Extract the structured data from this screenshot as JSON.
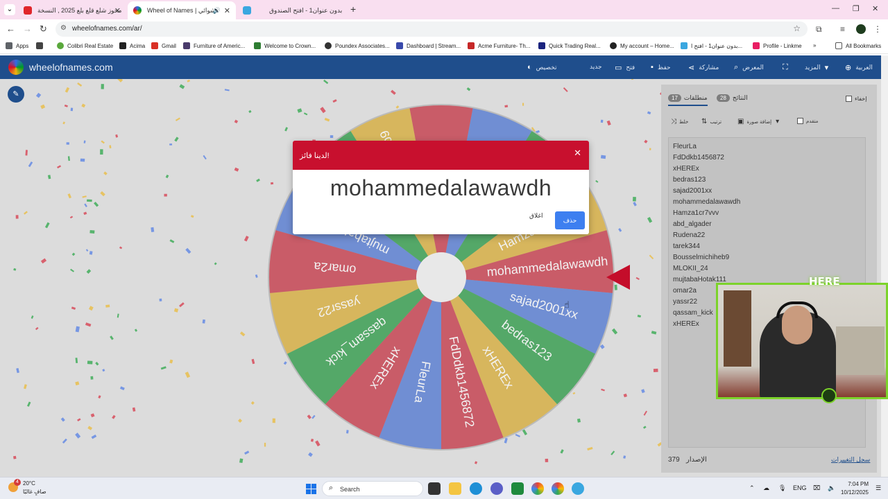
{
  "browser": {
    "tabs": [
      {
        "title": "محوز شلع قلع بلع 2025 , النسخة",
        "active": false
      },
      {
        "title": "Wheel of Names | العشوائي",
        "active": true
      },
      {
        "title": "بدون عنوان1 - افتح الصندوق",
        "active": false
      }
    ],
    "url": "wheelofnames.com/ar/",
    "bookmarks": [
      "Apps",
      "Colibri Real Estate",
      "Acima",
      "Gmail",
      "Furniture of Americ...",
      "Welcome to Crown...",
      "Poundex Associates...",
      "Dashboard | Stream...",
      "Acme Furniture- Th...",
      "Quick Trading Real...",
      "My account – Home...",
      "بدون عنوان1 - افتح ا...",
      "Profile - Linkme"
    ],
    "all_bookmarks": "All Bookmarks"
  },
  "app": {
    "brand": "wheelofnames.com",
    "header_items": {
      "language": "العربية",
      "more": "المزيد",
      "gallery": "المعرض",
      "share": "مشاركة",
      "save": "حفظ",
      "open": "فتح",
      "new": "جديد",
      "customize": "تخصيص"
    }
  },
  "wheel": {
    "segments": [
      {
        "label": "tarek344",
        "color": "#d50f25"
      },
      {
        "label": "Rudena22",
        "color": "#3369e8"
      },
      {
        "label": "abd_algader",
        "color": "#009925"
      },
      {
        "label": "Hamza1cr7vvv",
        "color": "#eeb211"
      },
      {
        "label": "mohammedalawawdh",
        "color": "#d50f25"
      },
      {
        "label": "sajad2001xx",
        "color": "#3369e8"
      },
      {
        "label": "bedras123",
        "color": "#009925"
      },
      {
        "label": "xHEREx",
        "color": "#eeb211"
      },
      {
        "label": "FdDdkb1456872",
        "color": "#d50f25"
      },
      {
        "label": "FleurLa",
        "color": "#3369e8"
      },
      {
        "label": "xHEREx",
        "color": "#d50f25"
      },
      {
        "label": "qassam_kick",
        "color": "#009925"
      },
      {
        "label": "yassr22",
        "color": "#eeb211"
      },
      {
        "label": "omar2a",
        "color": "#d50f25"
      },
      {
        "label": "mujtabaHotak111",
        "color": "#3369e8"
      },
      {
        "label": "MLOKII_24",
        "color": "#009925"
      },
      {
        "label": "Bousselmichiheb9",
        "color": "#eeb211"
      }
    ]
  },
  "panel": {
    "tabs": [
      {
        "label": "منطلقات",
        "count": "17",
        "active": true
      },
      {
        "label": "النتائج",
        "count": "28",
        "active": false
      }
    ],
    "hide_label": "إخفاء",
    "buttons": {
      "shuffle": "خلط",
      "sort": "ترتيب",
      "add_image": "إضافة صورة",
      "advanced": "متقدم"
    },
    "entries": [
      "FleurLa",
      "FdDdkb1456872",
      "xHEREx",
      "bedras123",
      "sajad2001xx",
      "mohammedalawawdh",
      "Hamza1cr7vvv",
      "abd_algader",
      "Rudena22",
      "tarek344",
      "Bousselmichiheb9",
      "MLOKII_24",
      "mujtabaHotak111",
      "omar2a",
      "yassr22",
      "qassam_kick",
      "xHEREx"
    ],
    "version_label": "الإصدار",
    "version": "379",
    "changelog": "سجل التغييرات"
  },
  "dialog": {
    "title": "لدينا فائز!",
    "winner": "mohammedalawawdh",
    "close_label": "اغلاق",
    "remove_label": "حذف"
  },
  "overlay": {
    "here": "HERE"
  },
  "taskbar": {
    "temperature": "20°C",
    "condition": "صافٍ غالبًا",
    "notifications": "4",
    "search": "Search",
    "language": "ENG",
    "time": "7:04 PM",
    "date": "10/12/2025"
  }
}
